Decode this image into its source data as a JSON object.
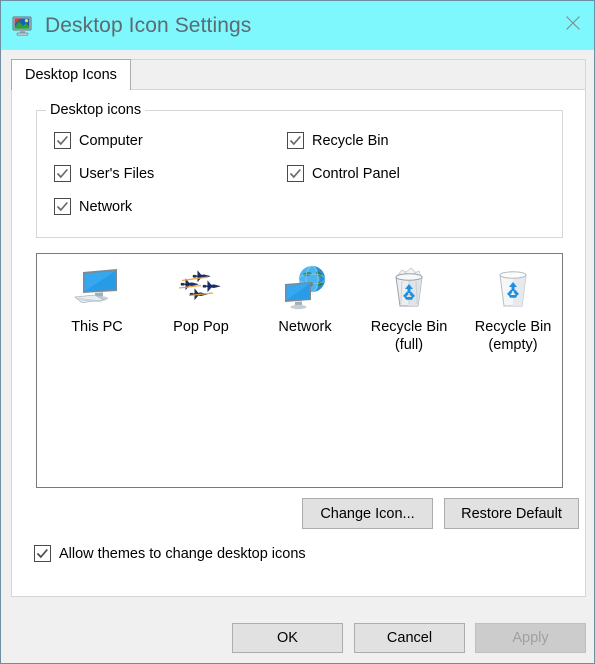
{
  "window": {
    "title": "Desktop Icon Settings",
    "title_icon": "desktop-monitor-icon",
    "close_icon": "close-icon",
    "titlebar_color": "#7EF8FC"
  },
  "tabs": [
    {
      "label": "Desktop Icons",
      "selected": true
    }
  ],
  "groupbox": {
    "title": "Desktop icons",
    "checkboxes": [
      {
        "label": "Computer",
        "checked": true,
        "column": "left",
        "row": 0
      },
      {
        "label": "User's Files",
        "checked": true,
        "column": "left",
        "row": 1
      },
      {
        "label": "Network",
        "checked": true,
        "column": "left",
        "row": 2
      },
      {
        "label": "Recycle Bin",
        "checked": true,
        "column": "right",
        "row": 0
      },
      {
        "label": "Control Panel",
        "checked": true,
        "column": "right",
        "row": 1
      }
    ]
  },
  "preview": {
    "icons": [
      {
        "label": "This PC",
        "icon": "monitor-icon"
      },
      {
        "label": "Pop Pop",
        "icon": "jets-icon"
      },
      {
        "label": "Network",
        "icon": "network-globe-icon"
      },
      {
        "label": "Recycle Bin\n(full)",
        "icon": "recycle-bin-full-icon"
      },
      {
        "label": "Recycle Bin\n(empty)",
        "icon": "recycle-bin-empty-icon"
      }
    ]
  },
  "buttons": {
    "change_icon": {
      "label": "Change Icon...",
      "enabled": true
    },
    "restore_default": {
      "label": "Restore Default",
      "enabled": true
    }
  },
  "allow_themes": {
    "label": "Allow themes to change desktop icons",
    "checked": true
  },
  "footer": {
    "ok": {
      "label": "OK",
      "enabled": true
    },
    "cancel": {
      "label": "Cancel",
      "enabled": true
    },
    "apply": {
      "label": "Apply",
      "enabled": false
    }
  }
}
